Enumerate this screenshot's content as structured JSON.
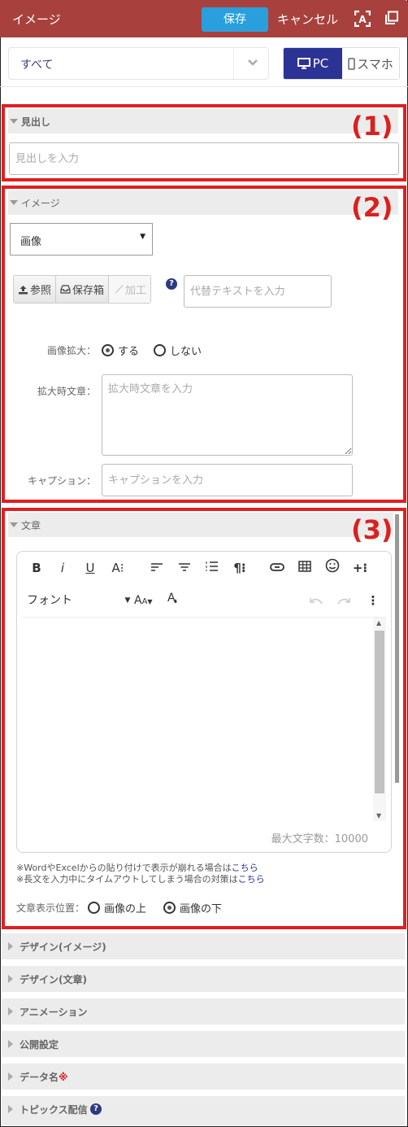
{
  "header": {
    "title": "イメージ",
    "save_label": "保存",
    "cancel_label": "キャンセル",
    "icons": [
      "text-recognition-icon",
      "duplicate-icon"
    ]
  },
  "filter": {
    "selected": "すべて",
    "device_pc": "PC",
    "device_sp": "スマホ",
    "active_device": "PC"
  },
  "annotations": [
    "(1)",
    "(2)",
    "(3)"
  ],
  "heading_section": {
    "label": "見出し",
    "placeholder": "見出しを入力"
  },
  "image_section": {
    "label": "イメージ",
    "type_select": "画像",
    "buttons": {
      "browse": "参照",
      "storage": "保存箱",
      "edit": "加工"
    },
    "alt_placeholder": "代替テキストを入力",
    "zoom_label": "画像拡大：",
    "zoom_options": [
      "する",
      "しない"
    ],
    "zoom_selected": "する",
    "zoom_text_label": "拡大時文章：",
    "zoom_text_placeholder": "拡大時文章を入力",
    "caption_label": "キャプション：",
    "caption_placeholder": "キャプションを入力"
  },
  "text_section": {
    "label": "文章",
    "toolbar_row1": [
      "B",
      "i",
      "U",
      "A⁝",
      "align-left",
      "align-center",
      "ordered-list",
      "¶⁝",
      "link",
      "table",
      "emoji",
      "+⁝"
    ],
    "font_label": "フォント",
    "counter": "最大文字数：10000",
    "note1_text": "※WordやExcelからの貼り付けで表示が崩れる場合は",
    "note1_link": "こちら",
    "note2_text": "※長文を入力中にタイムアウトしてしまう場合の対策は",
    "note2_link": "こちら",
    "position_label": "文章表示位置：",
    "position_options": [
      "画像の上",
      "画像の下"
    ],
    "position_selected": "画像の下"
  },
  "collapsed_sections": [
    {
      "label": "デザイン(イメージ)"
    },
    {
      "label": "デザイン(文章)"
    },
    {
      "label": "アニメーション"
    },
    {
      "label": "公開設定"
    },
    {
      "label": "データ名",
      "required_mark": "※"
    },
    {
      "label": "トピックス配信",
      "help": "?"
    }
  ],
  "colors": {
    "header_bg": "#a8413d",
    "save_btn": "#29a0dd",
    "pc_active": "#2b3394",
    "annotation_red": "#e01f1f"
  }
}
